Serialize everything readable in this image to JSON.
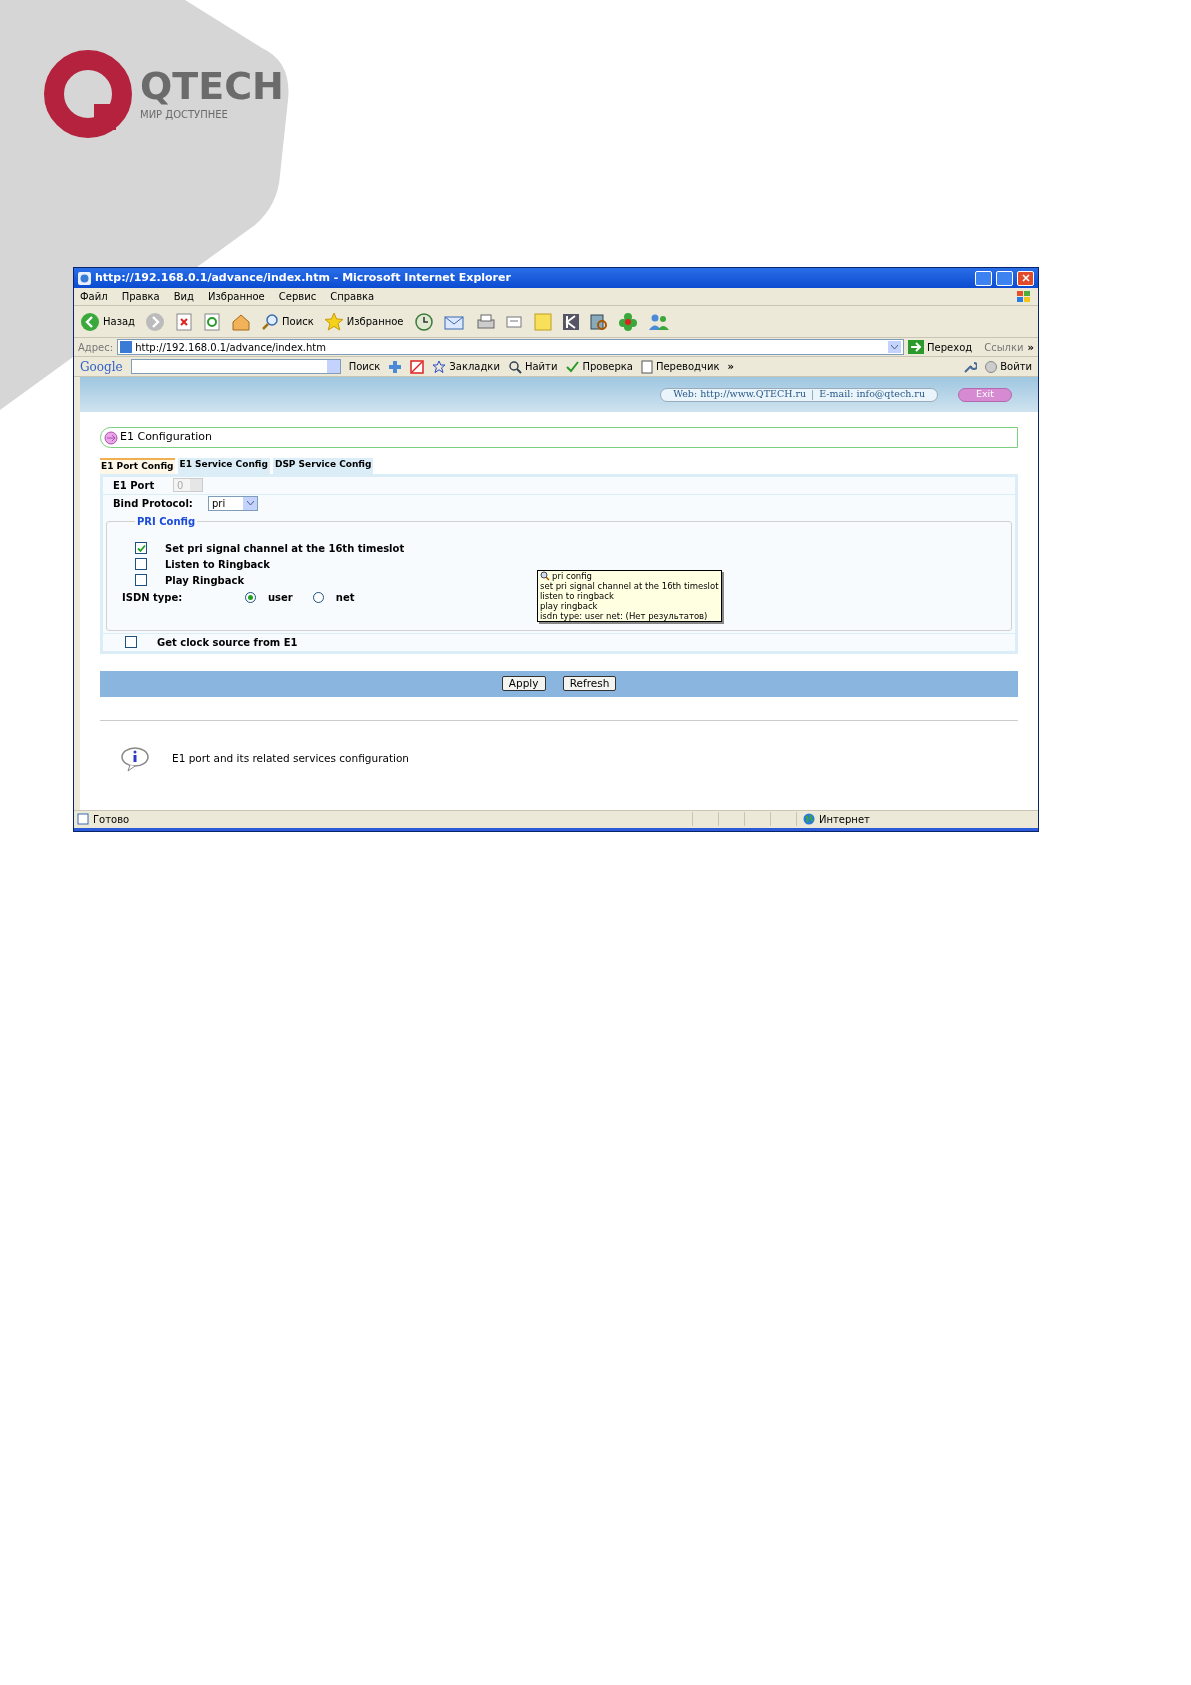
{
  "logo": {
    "name": "QTECH",
    "tagline": "МИР ДОСТУПНЕЕ"
  },
  "window": {
    "title": "http://192.168.0.1/advance/index.htm - Microsoft Internet Explorer"
  },
  "menu": [
    "Файл",
    "Правка",
    "Вид",
    "Избранное",
    "Сервис",
    "Справка"
  ],
  "toolbar": {
    "back": "Назад",
    "search": "Поиск",
    "favorites": "Избранное"
  },
  "address": {
    "label": "Адрес:",
    "value": "http://192.168.0.1/advance/index.htm",
    "go": "Переход",
    "links": "Ссылки",
    "more": "»"
  },
  "google_bar": {
    "logo": "Google",
    "search": "Поиск",
    "bookmarks": "Закладки",
    "find": "Найти",
    "check": "Проверка",
    "translate": "Переводчик",
    "more": "»",
    "login": "Войти"
  },
  "header": {
    "web": "Web: http://www.QTECH.ru",
    "email": "E-mail: info@qtech.ru",
    "exit": "Exit"
  },
  "section_title": "E1 Configuration",
  "tabs": [
    {
      "label": "E1 Port Config",
      "selected": true
    },
    {
      "label": "E1 Service Config",
      "selected": false
    },
    {
      "label": "DSP Service Config",
      "selected": false
    }
  ],
  "e1_port": {
    "label": "E1 Port",
    "value": "0",
    "disabled": true
  },
  "bind_protocol": {
    "label": "Bind Protocol:",
    "value": "pri"
  },
  "pri_config": {
    "title": "PRI Config",
    "options": [
      {
        "label": "Set pri signal channel at the 16th timeslot",
        "checked": true
      },
      {
        "label": "Listen to Ringback",
        "checked": false
      },
      {
        "label": "Play Ringback",
        "checked": false
      }
    ],
    "isdn": {
      "label": "ISDN type:",
      "choices": [
        {
          "label": "user",
          "selected": true
        },
        {
          "label": "net",
          "selected": false
        }
      ]
    }
  },
  "tooltip": [
    "pri config",
    "set pri signal channel at the 16th timeslot",
    "listen to ringback",
    "play ringback",
    "isdn type: user net: (Нет результатов)"
  ],
  "clock": {
    "label": "Get clock source from E1",
    "checked": false
  },
  "buttons": [
    "Apply",
    "Refresh"
  ],
  "info": "E1 port and its related services configuration",
  "status_bar": {
    "text": "Готово",
    "zone": "Интернет"
  }
}
